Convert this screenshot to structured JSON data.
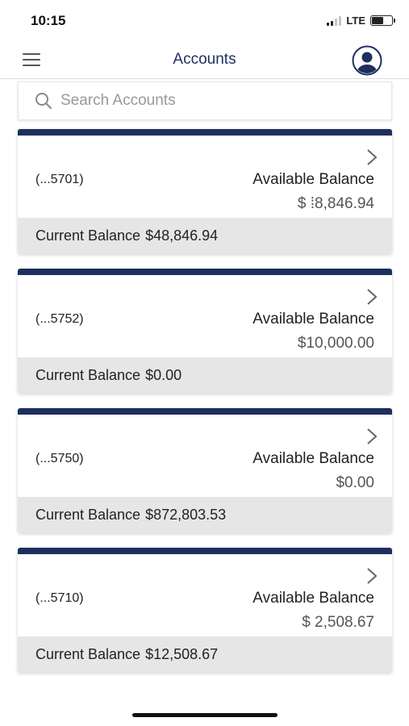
{
  "status_bar": {
    "time": "10:15",
    "network": "LTE"
  },
  "nav": {
    "title": "Accounts"
  },
  "search": {
    "placeholder": "Search Accounts"
  },
  "accounts": [
    {
      "number": "(...5701)",
      "available_label": "Available Balance",
      "available_value": "$ ⁞8,846.94",
      "current_label": "Current Balance",
      "current_value": "$48,846.94"
    },
    {
      "number": "(...5752)",
      "available_label": "Available Balance",
      "available_value": "$10,000.00",
      "current_label": "Current Balance",
      "current_value": "$0.00"
    },
    {
      "number": "(...5750)",
      "available_label": "Available Balance",
      "available_value": "$0.00",
      "current_label": "Current Balance",
      "current_value": "$872,803.53"
    },
    {
      "number": "(...5710)",
      "available_label": "Available Balance",
      "available_value": "$  2,508.67",
      "current_label": "Current Balance",
      "current_value": "$12,508.67"
    }
  ],
  "colors": {
    "brand_navy": "#1d2f5e",
    "footer_gray": "#e6e6e6"
  },
  "icons": {
    "menu": "hamburger-menu-icon",
    "profile": "profile-avatar-icon",
    "search": "search-icon",
    "chevron": "chevron-right-icon"
  }
}
